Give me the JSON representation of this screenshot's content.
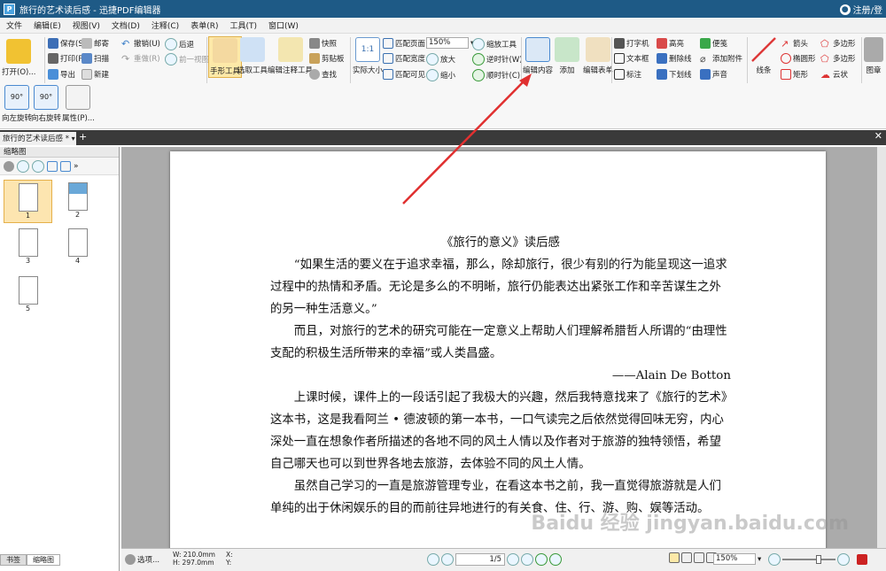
{
  "window": {
    "title": "旅行的艺术读后感 - 迅捷PDF编辑器",
    "user": "注册/登"
  },
  "menu": [
    "文件",
    "编辑(E)",
    "视图(V)",
    "文档(D)",
    "注释(C)",
    "表单(R)",
    "工具(T)",
    "窗口(W)"
  ],
  "toolbar": {
    "open": "打开(O)...",
    "save": "保存(S)",
    "print": "打印(P)...",
    "export": "导出",
    "email": "邮寄",
    "scan": "扫描",
    "new": "新建",
    "undo": "撤销(U)",
    "redo": "重做(R)",
    "back": "后退",
    "forward": "前一视图",
    "hand_tool": "手形工具",
    "select_tool": "选取工具",
    "edit_annot_tool": "编辑注释工具",
    "snapshot": "快照",
    "clipboard": "剪贴板",
    "find": "查找",
    "actual_size": "实际大小",
    "fit_page": "匹配页面",
    "fit_width": "匹配宽度",
    "fit_visible": "匹配可见",
    "zoom_value": "150%",
    "zoom_tool": "缩放工具",
    "zoom_in": "放大",
    "zoom_out": "缩小",
    "rotate_ccw": "逆时针(W)",
    "rotate_cw": "顺时针(C)",
    "edit_content": "编辑内容",
    "add": "添加",
    "edit_form": "编辑表单",
    "typewriter": "打字机",
    "textbox": "文本框",
    "callout": "标注",
    "highlight": "高亮",
    "strikeout": "删除线",
    "underline": "下划线",
    "note": "便笺",
    "attach": "添加附件",
    "sound": "声音",
    "line": "线条",
    "arrow": "箭头",
    "ellipse": "椭圆形",
    "rect": "矩形",
    "polygon": "多边形",
    "polyline": "多边形",
    "cloud": "云状",
    "stamp": "图章",
    "rotate_left": "向左旋转",
    "rotate_right": "向右旋转",
    "properties": "属性(P)..."
  },
  "tab": {
    "label": "旅行的艺术读后感 *"
  },
  "sidebar": {
    "title": "缩略图",
    "pages": [
      "1",
      "2",
      "3",
      "4",
      "5"
    ],
    "tab_bookmarks": "书签",
    "tab_thumbs": "缩略图"
  },
  "document": {
    "heading": "《旅行的意义》读后感",
    "para1": "“如果生活的要义在于追求幸福，那么，除却旅行，很少有别的行为能呈现这一追求过程中的热情和矛盾。无论是多么的不明晰，旅行仍能表达出紧张工作和辛苦谋生之外的另一种生活意义。”",
    "para2": "而且，对旅行的艺术的研究可能在一定意义上帮助人们理解希腊哲人所谓的“由理性支配的积极生活所带来的幸福”或人类昌盛。",
    "attribution": "——Alain De Botton",
    "para3": "上课时候，课件上的一段话引起了我极大的兴趣，然后我特意找来了《旅行的艺术》这本书，这是我看阿兰 • 德波顿的第一本书，一口气读完之后依然觉得回味无穷，内心深处一直在想象作者所描述的各地不同的风土人情以及作者对于旅游的独特领悟，希望自己哪天也可以到世界各地去旅游，去体验不同的风土人情。",
    "para4": "虽然自己学习的一直是旅游管理专业，在看这本书之前，我一直觉得旅游就是人们单纯的出于休闲娱乐的目的而前往异地进行的有关食、住、行、游、购、娱等活动。"
  },
  "status": {
    "options": "选项...",
    "width": "W: 210.0mm",
    "height": "H: 297.0mm",
    "x": "X:",
    "y": "Y:",
    "page": "1/5",
    "zoom": "150%"
  },
  "watermark": "Baidu 经验 jingyan.baidu.com",
  "colors": {
    "titlebar": "#1e5a86",
    "arrow": "#e03030",
    "selected": "#fde9a8"
  }
}
